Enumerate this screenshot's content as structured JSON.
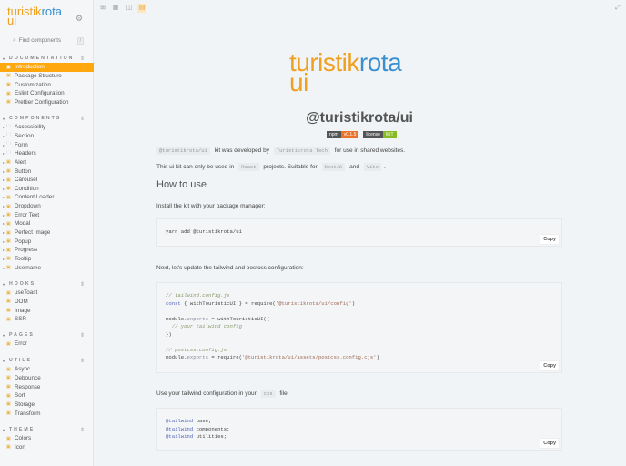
{
  "sidebar": {
    "logo": {
      "part1": "turistik",
      "part2": "rota",
      "part3": "ui"
    },
    "search_placeholder": "Find components",
    "search_shortcut": "/",
    "sections": [
      {
        "title": "DOCUMENTATION",
        "items": [
          "Introduction",
          "Package Structure",
          "Customization",
          "Eslint Configuration",
          "Prettier Configuration"
        ]
      },
      {
        "title": "COMPONENTS",
        "items": [
          "Accessibility",
          "Section",
          "Form",
          "Headers",
          "Alert",
          "Button",
          "Carousel",
          "Condition",
          "Content Loader",
          "Dropdown",
          "Error Text",
          "Modal",
          "Perfect Image",
          "Popup",
          "Progress",
          "Tooltip",
          "Username"
        ]
      },
      {
        "title": "HOOKS",
        "items": [
          "useToast",
          "DOM",
          "Image",
          "SSR"
        ]
      },
      {
        "title": "PAGES",
        "items": [
          "Error"
        ]
      },
      {
        "title": "UTILS",
        "items": [
          "Async",
          "Debounce",
          "Response",
          "Sort",
          "Storage",
          "Transform"
        ]
      },
      {
        "title": "THEME",
        "items": [
          "Colors",
          "Icon"
        ]
      }
    ]
  },
  "main": {
    "logo": {
      "part1": "turistik",
      "part2": "rota",
      "part3": "ui"
    },
    "title": "@turistikrota/ui",
    "badges": [
      {
        "label": "npm",
        "value": "v0.1.5",
        "color": "#e8742a"
      },
      {
        "label": "license",
        "value": "MIT",
        "color": "#88bb22"
      }
    ],
    "intro1": {
      "code1": "@turistikrota/ui",
      "text1": "kit was developed by",
      "code2": "Turistikrota Tech",
      "text2": "for use in shared websites."
    },
    "intro2": {
      "text1": "This ui kit can only be used in",
      "code1": "React",
      "text2": "projects. Suitable for",
      "code2": "NextJS",
      "text3": "and",
      "code3": "Vite",
      "text4": "."
    },
    "how_to_use": "How to use",
    "install_text": "Install the kit with your package manager:",
    "install_code": "yarn add @turistikrota/ui",
    "next_text": "Next, let's update the tailwind and postcss configuration:",
    "config": {
      "c1": "// tailwind.config.js",
      "kw": "const",
      "l2a": " { withTouristicUI } = require(",
      "l2s": "'@turistikrota/ui/config'",
      "l2b": ")",
      "l4a": "module.",
      "l4p": "exports",
      "l4b": " = withTouristicUI({",
      "c2": "  // your tailwind config",
      "l6": "})",
      "c3": "// postcss.config.js",
      "l8a": "module.",
      "l8p": "exports",
      "l8b": " = require(",
      "l8s": "'@turistikrota/ui/assets/postcss.config.cjs'",
      "l8c": ")"
    },
    "css_text": {
      "text1": "Use your tailwind configuration in your",
      "code": "css",
      "text2": "file:"
    },
    "css_code": {
      "at": "@tailwind",
      "l1": " base;",
      "l2": " components;",
      "l3": " utilities;"
    },
    "copy_label": "Copy"
  }
}
